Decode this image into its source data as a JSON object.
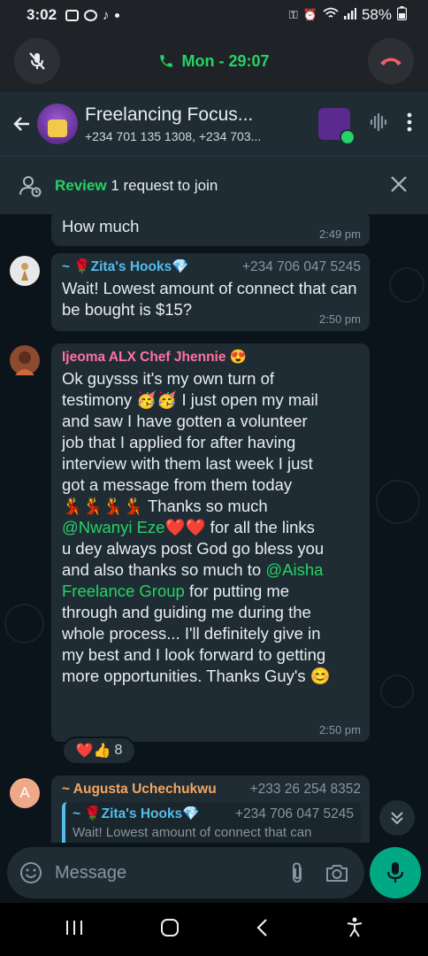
{
  "status_bar": {
    "time": "3:02",
    "battery": "58%"
  },
  "call": {
    "status": "Mon - 29:07"
  },
  "header": {
    "title": "Freelancing Focus...",
    "subtitle": "+234 701 135 1308, +234 703..."
  },
  "review": {
    "action": "Review",
    "text": "1 request to join"
  },
  "messages": [
    {
      "text": "How much",
      "time": "2:49 pm"
    },
    {
      "sender": "~ 🌹Zita's Hooks💎",
      "phone": "+234 706 047 5245",
      "text": "Wait! Lowest amount of connect that can be bought is $15?",
      "time": "2:50 pm"
    },
    {
      "sender": "Ijeoma ALX Chef Jhennie 😍",
      "lines": {
        "l1": "Ok guysss it's my own turn of",
        "l2a": "testimony ",
        "l2_emoji": "🥳🥳",
        "l2b": " I just open my mail",
        "l3": "and saw I have gotten a volunteer",
        "l4": "job that I applied for after having",
        "l5": "interview with them last week  I just",
        "l6": "got a message from them today",
        "l7_emoji": "💃💃💃💃",
        "l7b": " Thanks so much",
        "l8_mention": "@Nwanyi Eze",
        "l8_emoji": " ❤️❤️",
        "l8b": "  for all the links",
        "l9": "u dey always post God go bless you",
        "l10a": "and also thanks so much to ",
        "l10_mention": "@Aisha",
        "l11_mention": "Freelance Group",
        "l11b": " for putting me",
        "l12": "through and guiding me during the",
        "l13": "whole process... I'll definitely give in",
        "l14": "my best and I look forward to getting",
        "l15a": "more opportunities. Thanks Guy's ",
        "l15_emoji": "😊"
      },
      "time": "2:50 pm",
      "reactions": {
        "emojis": "❤️👍",
        "count": "8"
      }
    },
    {
      "avatar_letter": "A",
      "sender": "~ Augusta Uchechukwu",
      "phone": "+233 26 254 8352",
      "quote_sender": "~ 🌹Zita's Hooks💎",
      "quote_phone": "+234 706 047 5245",
      "quote_text": "Wait! Lowest amount of connect that can"
    }
  ],
  "composer": {
    "placeholder": "Message"
  },
  "colors": {
    "accent_green": "#25d366",
    "sender_blue": "#53bdeb",
    "sender_pink": "#ff72a1",
    "sender_orange": "#f5a561",
    "end_call_red": "#f15c6d"
  }
}
